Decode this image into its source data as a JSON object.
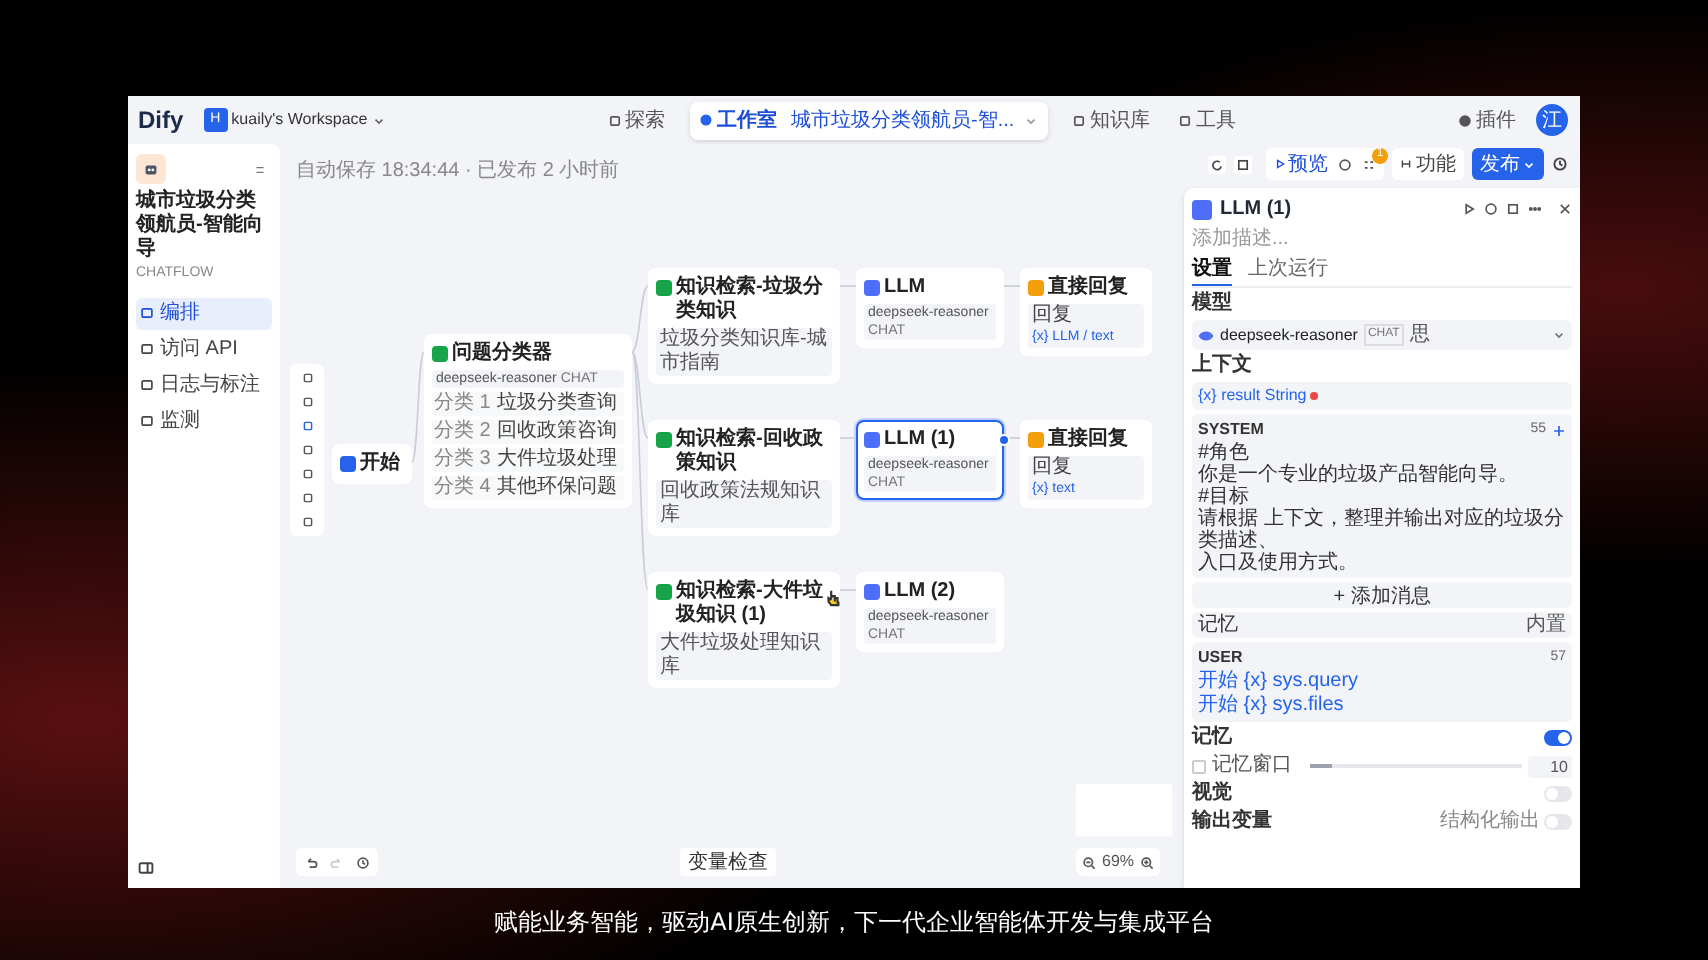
{
  "logo": "Dify",
  "workspace": {
    "initial": "H",
    "name": "kuaily's Workspace"
  },
  "nav": [
    {
      "label": "探索",
      "selected": false
    },
    {
      "label": "工作室",
      "selected": true,
      "crumb": "城市垃圾分类领航员-智..."
    },
    {
      "label": "知识库",
      "selected": false
    },
    {
      "label": "工具",
      "selected": false
    }
  ],
  "plugins": "插件",
  "user_initial": "江",
  "sidebar": {
    "app_name": "城市垃圾分类领航员-智能向导",
    "app_type": "CHATFLOW",
    "items": [
      {
        "label": "编排",
        "selected": true
      },
      {
        "label": "访问 API",
        "selected": false
      },
      {
        "label": "日志与标注",
        "selected": false
      },
      {
        "label": "监测",
        "selected": false
      }
    ]
  },
  "autosave": "自动保存 18:34:44 · 已发布 2 小时前",
  "toolbar": {
    "preview": "预览",
    "badge": "1",
    "features": "功能",
    "publish": "发布"
  },
  "nodes": [
    {
      "kind": "start",
      "title": "开始",
      "selected": false
    },
    {
      "kind": "classifier",
      "title": "问题分类器",
      "model": "deepseek-reasoner",
      "mode": "CHAT",
      "selected": false,
      "classes": [
        {
          "label": "分类 1",
          "text": "垃圾分类查询"
        },
        {
          "label": "分类 2",
          "text": "回收政策咨询"
        },
        {
          "label": "分类 3",
          "text": "大件垃圾处理"
        },
        {
          "label": "分类 4",
          "text": "其他环保问题"
        }
      ]
    },
    {
      "kind": "knowledge",
      "title": "知识检索-垃圾分类知识",
      "dataset": "垃圾分类知识库-城市指南",
      "selected": false
    },
    {
      "kind": "knowledge",
      "title": "知识检索-回收政策知识",
      "dataset": "回收政策法规知识库",
      "selected": false
    },
    {
      "kind": "knowledge",
      "title": "知识检索-大件垃圾知识 (1)",
      "dataset": "大件垃圾处理知识库",
      "selected": false
    },
    {
      "kind": "llm",
      "title": "LLM",
      "model": "deepseek-reasoner",
      "mode": "CHAT",
      "selected": false
    },
    {
      "kind": "llm",
      "title": "LLM (1)",
      "model": "deepseek-reasoner",
      "mode": "CHAT",
      "selected": true
    },
    {
      "kind": "llm",
      "title": "LLM (2)",
      "model": "deepseek-reasoner",
      "mode": "CHAT",
      "selected": false
    },
    {
      "kind": "answer",
      "title": "直接回复",
      "field": "回复",
      "value": "{x} LLM / text",
      "selected": false
    },
    {
      "kind": "answer",
      "title": "直接回复",
      "field": "回复",
      "value": "{x} text",
      "selected": false
    }
  ],
  "panel": {
    "title": "LLM (1)",
    "description": "添加描述...",
    "tabs": [
      {
        "label": "设置",
        "selected": true
      },
      {
        "label": "上次运行",
        "selected": false
      }
    ],
    "model_label": "模型",
    "model": "deepseek-reasoner",
    "mode": "CHAT",
    "model_tag": "思",
    "context_label": "上下文",
    "context_var": "{x} result String",
    "system": {
      "role": "SYSTEM",
      "count": "55",
      "lines": [
        "#角色",
        "你是一个专业的垃圾产品智能向导。",
        "#目标",
        "请根据 上下文，整理并输出对应的垃圾分类描述、",
        "入口及使用方式。"
      ]
    },
    "add_message": "+ 添加消息",
    "memory_row": {
      "label": "记忆",
      "value": "内置"
    },
    "user": {
      "role": "USER",
      "count": "57",
      "vars": [
        "开始 {x} sys.query",
        "开始 {x} sys.files"
      ]
    },
    "memory": {
      "label": "记忆",
      "on": true
    },
    "window": {
      "label": "记忆窗口",
      "checked": false,
      "level": 0.1,
      "value": "10"
    },
    "vision": {
      "label": "视觉",
      "on": false
    },
    "output": {
      "label": "输出变量",
      "structured": "结构化输出",
      "on": false
    }
  },
  "variable_check": "变量检查",
  "zoom": "69%",
  "subtitle": "赋能业务智能，驱动AI原生创新，下一代企业智能体开发与集成平台"
}
